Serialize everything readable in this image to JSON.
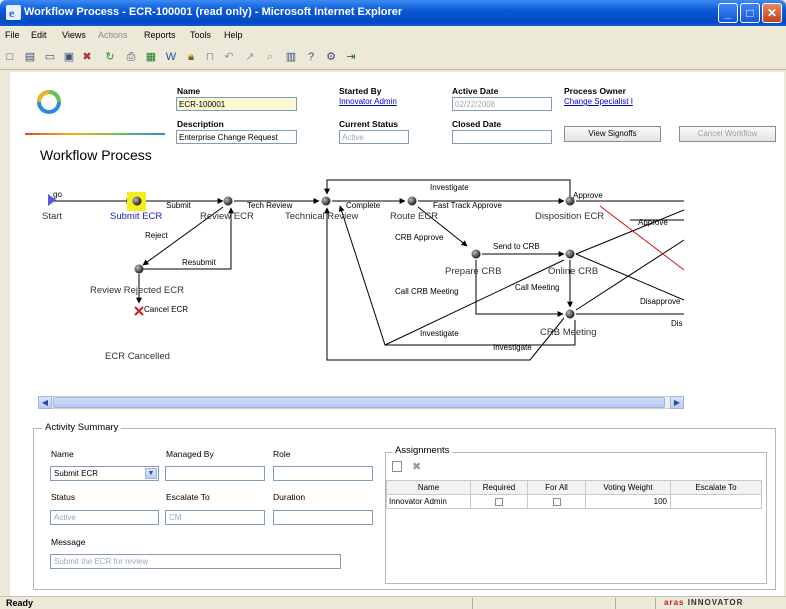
{
  "window": {
    "title": "Workflow Process - ECR-100001 (read only) - Microsoft Internet Explorer"
  },
  "menu": [
    "File",
    "Edit",
    "Views",
    "Actions",
    "Reports",
    "Tools",
    "Help"
  ],
  "header": {
    "name_label": "Name",
    "name_value": "ECR-100001",
    "description_label": "Description",
    "description_value": "Enterprise Change Request",
    "started_by_label": "Started By",
    "started_by_value": "Innovator Admin",
    "current_status_label": "Current Status",
    "current_status_value": "Active",
    "active_date_label": "Active Date",
    "active_date_value": "02/22/2008",
    "closed_date_label": "Closed Date",
    "closed_date_value": "",
    "process_owner_label": "Process Owner",
    "process_owner_value": "Change Specialist I",
    "view_signoffs": "View Signoffs",
    "cancel_workflow": "Cancel Workflow"
  },
  "workflow_title": "Workflow Process",
  "diagram": {
    "nodes": {
      "start": "Start",
      "submit_ecr": "Submit ECR",
      "review_ecr": "Review ECR",
      "technical_review": "Technical Review",
      "route_ecr": "Route ECR",
      "disposition_ecr": "Disposition ECR",
      "prepare_crb": "Prepare CRB",
      "online_crb": "Online CRB",
      "crb_meeting": "CRB Meeting",
      "review_rejected_ecr": "Review Rejected ECR",
      "ecr_cancelled": "ECR Cancelled"
    },
    "paths": {
      "go": "go",
      "submit": "Submit",
      "tech_review": "Tech Review",
      "complete": "Complete",
      "investigate_top": "Investigate",
      "fast_track_approve": "Fast Track Approve",
      "approve_top": "Approve",
      "approve_right": "Approve",
      "crb_approve": "CRB Approve",
      "send_to_crb": "Send to CRB",
      "reject": "Reject",
      "resubmit": "Resubmit",
      "call_crb_meeting": "Call CRB Meeting",
      "call_meeting": "Call Meeting",
      "disapprove": "Disapprove",
      "dis": "Dis",
      "cancel_ecr": "Cancel ECR",
      "investigate_mid": "Investigate",
      "investigate_bottom": "Investigate"
    }
  },
  "activity_summary": {
    "legend": "Activity Summary",
    "name_label": "Name",
    "name_value": "Submit ECR",
    "managed_by_label": "Managed By",
    "managed_by_value": "",
    "role_label": "Role",
    "role_value": "",
    "status_label": "Status",
    "status_value": "Active",
    "escalate_to_label": "Escalate To",
    "escalate_to_value": "CM",
    "duration_label": "Duration",
    "duration_value": "",
    "message_label": "Message",
    "message_value": "Submit the ECR for review"
  },
  "assignments": {
    "legend": "Assignments",
    "columns": [
      "Name",
      "Required",
      "For All",
      "Voting Weight",
      "Escalate To"
    ],
    "rows": [
      {
        "name": "Innovator Admin",
        "required": false,
        "for_all": false,
        "voting_weight": "100",
        "escalate_to": ""
      }
    ]
  },
  "status_bar": {
    "text": "Ready",
    "brand_prefix": "aras",
    "brand": "INNOVATOR"
  },
  "colors": {
    "titlebar": "#0a5ad6",
    "link": "#0000cc",
    "highlight": "#f2ef1c",
    "cancel_mark": "#cc2020",
    "red_line": "#e01010"
  }
}
